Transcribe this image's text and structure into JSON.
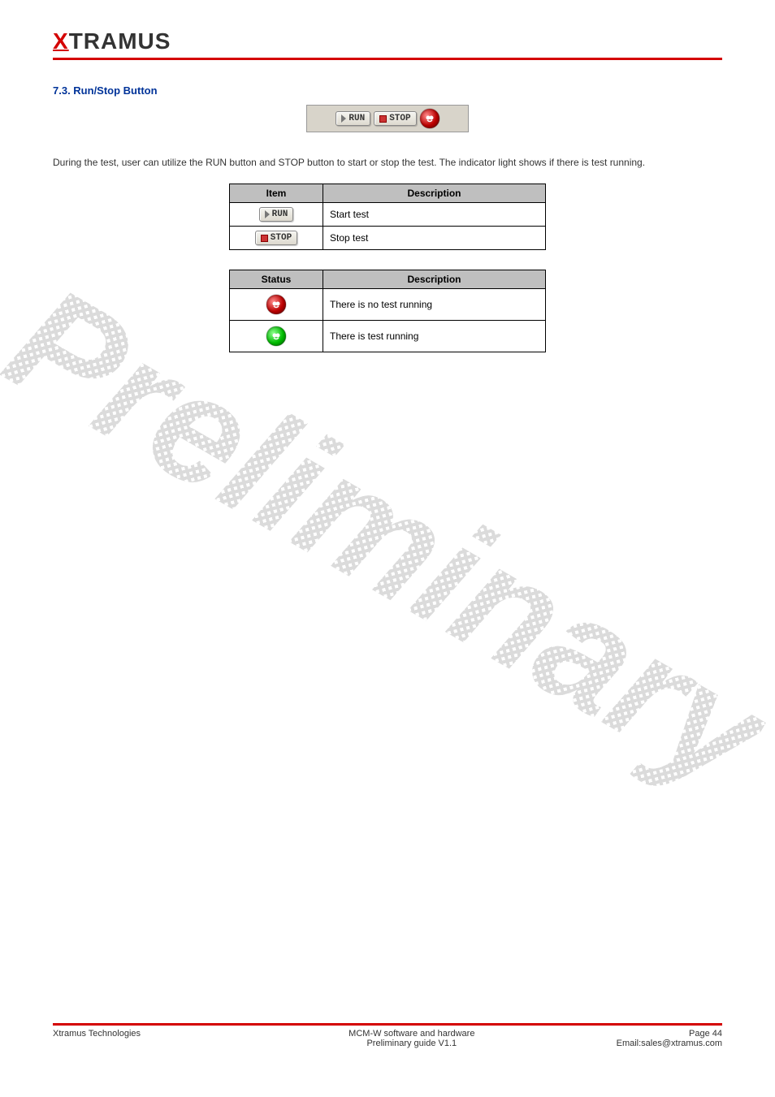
{
  "logo": {
    "x": "X",
    "rest": "TRAMUS"
  },
  "section_title": "7.3. Run/Stop Button",
  "toolbar": {
    "run_label": "RUN",
    "stop_label": "STOP"
  },
  "paragraph": "During the test, user can utilize the RUN button and STOP button to start or stop the test. The indicator light shows if there is test running.",
  "table1": {
    "header_item": "Item",
    "header_desc": "Description",
    "run_desc": "Start test",
    "stop_desc": "Stop test"
  },
  "table2": {
    "header_status": "Status",
    "header_desc": "Description",
    "red_desc": "There is no test running",
    "green_desc": "There is test running"
  },
  "watermark": "Preliminary",
  "footer": {
    "left": "Xtramus Technologies",
    "center_top": "MCM-W software and hardware",
    "center_bottom": "Preliminary guide V1.1",
    "right_page": "Page 44",
    "right_email": "Email:sales@xtramus.com"
  }
}
